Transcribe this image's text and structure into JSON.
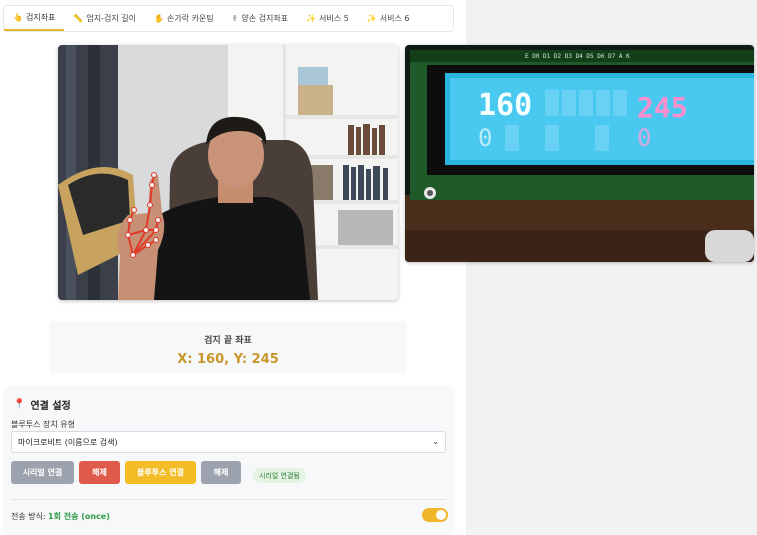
{
  "tabs": [
    {
      "icon": "👆",
      "label": "검지좌표",
      "active": true
    },
    {
      "icon": "📏",
      "label": "엄지-검지 길이"
    },
    {
      "icon": "✋",
      "label": "손가락 카운팅"
    },
    {
      "icon": "✌",
      "label": "양손 검지좌표"
    },
    {
      "icon": "✨",
      "label": "서비스 5"
    },
    {
      "icon": "✨",
      "label": "서비스 6"
    }
  ],
  "lcd": {
    "x_text": "160",
    "y_text": "245",
    "zero1": "0",
    "zero2": "0",
    "pin_labels": "E  D0 D1 D2 D3 D4 D5 D6 D7  A  K"
  },
  "coordinate": {
    "label": "검지 끝 좌표",
    "value": "X: 160, Y: 245"
  },
  "settings": {
    "icon": "📍",
    "title": "연결 설정",
    "device_label": "블루투스 장치 유형",
    "device_selected": "마이크로비트 (이름으로 검색)",
    "buttons": {
      "serial_connect": "시리얼 연결",
      "serial_disconnect": "해제",
      "bt_connect": "블루투스 연결",
      "bt_disconnect": "해제"
    },
    "status": "시리얼 연결됨",
    "mode_label": "전송 방식:",
    "mode_value": "1회 전송 (once)"
  },
  "colors": {
    "accent": "#e7b72b",
    "danger": "#e05a4b",
    "success": "#2e9d47"
  }
}
